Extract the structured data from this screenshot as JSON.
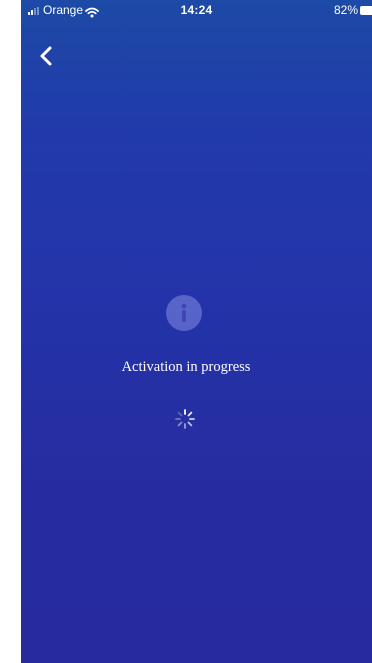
{
  "status_bar": {
    "carrier": "Orange",
    "time": "14:24",
    "battery_percent": "82%",
    "icons": [
      "signal-icon",
      "wifi-icon",
      "battery-icon"
    ]
  },
  "navigation": {
    "back_icon": "chevron-left-icon"
  },
  "main": {
    "icon": "info-icon",
    "message": "Activation in progress",
    "loading_icon": "spinner-icon"
  },
  "colors": {
    "gradient_top": "#1d4aa6",
    "gradient_bottom": "#262a9c",
    "text": "#ffffff"
  }
}
